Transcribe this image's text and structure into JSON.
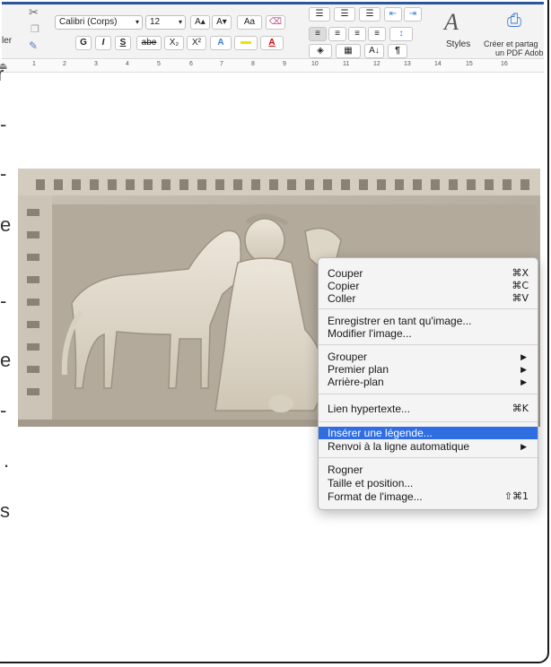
{
  "ribbon": {
    "left_partial_label": "ler",
    "font_name": "Calibri (Corps)",
    "font_size": "12",
    "grow_font": "A▴",
    "shrink_font": "A▾",
    "change_case": "Aa",
    "bold": "G",
    "italic": "I",
    "underline": "S",
    "strikethrough": "abe",
    "subscript": "X₂",
    "superscript": "X²",
    "text_effects": "A",
    "font_color": "A",
    "sort": "A↓",
    "pilcrow": "¶",
    "styles_label": "Styles",
    "share_label_line1": "Créer et partag",
    "share_label_line2": "un PDF Adob"
  },
  "ruler": {
    "numbers": [
      "1",
      "2",
      "3",
      "4",
      "5",
      "6",
      "7",
      "8",
      "9",
      "10",
      "11",
      "12",
      "13",
      "14",
      "15",
      "16"
    ]
  },
  "document": {
    "edge_chars": [
      "r",
      "-",
      "-",
      "e",
      "-",
      "e",
      "-",
      ".",
      "s"
    ]
  },
  "context_menu": {
    "items": [
      {
        "label": "Couper",
        "shortcut": "⌘X"
      },
      {
        "label": "Copier",
        "shortcut": "⌘C"
      },
      {
        "label": "Coller",
        "shortcut": "⌘V"
      },
      {
        "label": "Enregistrer en tant qu'image...",
        "shortcut": ""
      },
      {
        "label": "Modifier l'image...",
        "shortcut": ""
      },
      {
        "label": "Grouper",
        "shortcut": "▶"
      },
      {
        "label": "Premier plan",
        "shortcut": "▶"
      },
      {
        "label": "Arrière-plan",
        "shortcut": "▶"
      },
      {
        "label": "Lien hypertexte...",
        "shortcut": "⌘K"
      },
      {
        "label": "Insérer une légende...",
        "shortcut": ""
      },
      {
        "label": "Renvoi à la ligne automatique",
        "shortcut": "▶"
      },
      {
        "label": "Rogner",
        "shortcut": ""
      },
      {
        "label": "Taille et position...",
        "shortcut": ""
      },
      {
        "label": "Format de l'image...",
        "shortcut": "⇧⌘1"
      }
    ],
    "highlighted_item": "Insérer une légende..."
  },
  "colors": {
    "ribbon_accent": "#2b579a",
    "menu_highlight": "#2f6de1",
    "highlighter_yellow": "#f5e100",
    "font_color_red": "#d40000"
  }
}
